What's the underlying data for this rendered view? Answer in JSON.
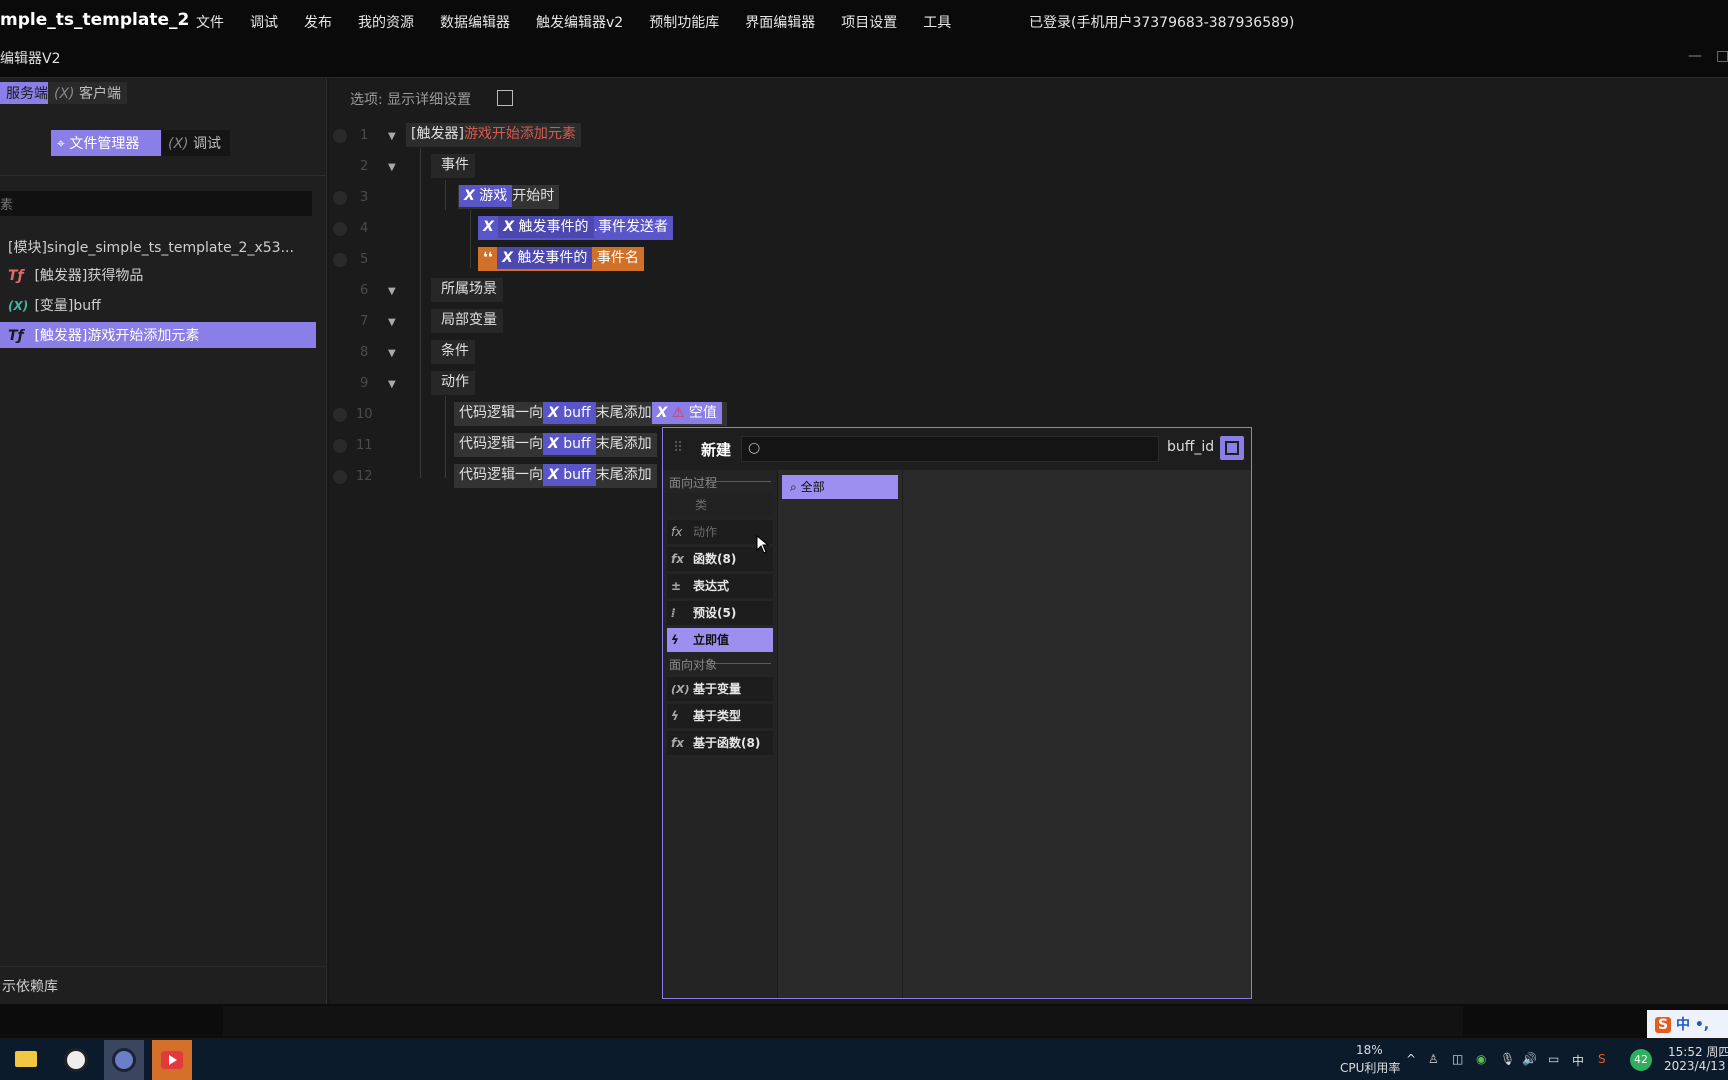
{
  "app": {
    "title": "mple_ts_template_2",
    "window_title": "编辑器V2",
    "login": "已登录(手机用户37379683-387936589)"
  },
  "menu": [
    "文件",
    "调试",
    "发布",
    "我的资源",
    "数据编辑器",
    "触发编辑器v2",
    "预制功能库",
    "界面编辑器",
    "项目设置",
    "工具"
  ],
  "left": {
    "tab_server": "服务端",
    "tab_client": "客户端",
    "btn_file_manager": "文件管理器",
    "btn_debug": "调试",
    "search_placeholder": "素",
    "files": [
      {
        "icon": "",
        "label": "[模块]single_simple_ts_template_2_x53..."
      },
      {
        "icon": "Tƒ",
        "label": "[触发器]获得物品"
      },
      {
        "icon": "(X)",
        "label": "[变量]buff"
      },
      {
        "icon": "Tƒ",
        "label": "[触发器]游戏开始添加元素"
      }
    ],
    "deps": "示依赖库"
  },
  "editor": {
    "option_label": "选项: 显示详细设置",
    "line_numbers": [
      "1",
      "2",
      "3",
      "4",
      "5",
      "6",
      "7",
      "8",
      "9",
      "10",
      "11",
      "12"
    ],
    "trigger_prefix": "[触发器]",
    "trigger_name": "游戏开始添加元素",
    "event": "事件",
    "game": "游戏",
    "on_start": "开始时",
    "trigger_event_of": "触发事件的",
    "sender": ".事件发送者",
    "event_name": ".事件名",
    "scene": "所属场景",
    "local_vars": "局部变量",
    "condition": "条件",
    "action": "动作",
    "code_logic": "代码逻辑一向",
    "buff": "buff",
    "append_end": "末尾添加",
    "null_value": "空值"
  },
  "popup": {
    "new_label": "新建",
    "search_value": "",
    "buff_id": "buff_id",
    "group_process": "面向过程",
    "group_object": "面向对象",
    "categories": [
      {
        "icon": "",
        "label": "类"
      },
      {
        "icon": "fx",
        "label": "动作"
      },
      {
        "icon": "fx",
        "label": "函数(8)"
      },
      {
        "icon": "±",
        "label": "表达式"
      },
      {
        "icon": "⁞",
        "label": "预设(5)"
      },
      {
        "icon": "ϟ",
        "label": "立即值"
      },
      {
        "icon": "(X)",
        "label": "基于变量"
      },
      {
        "icon": "ϟ",
        "label": "基于类型"
      },
      {
        "icon": "fx",
        "label": "基于函数(8)"
      }
    ],
    "all_label": "全部"
  },
  "taskbar": {
    "cpu_percent": "18%",
    "cpu_label": "CPU利用率",
    "time": "15:52 周四",
    "date": "2023/4/13",
    "ime": "中 •,",
    "ime_mode": "中",
    "badge": "42"
  },
  "colors": {
    "accent": "#8a7fe6",
    "chip_blue": "#5a55c9",
    "chip_orange": "#d07029",
    "trigger_red": "#d65a4d"
  }
}
